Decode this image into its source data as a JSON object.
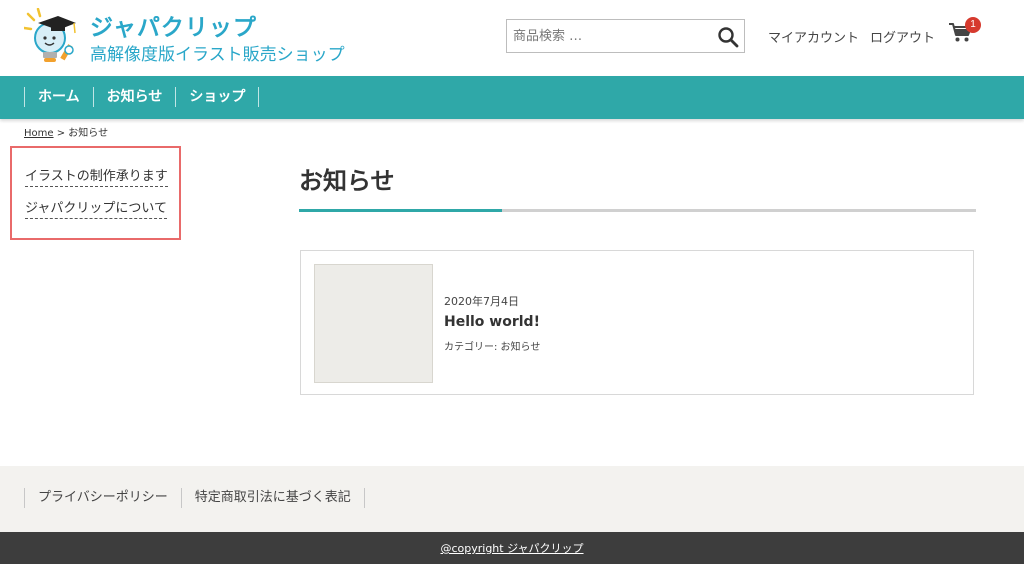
{
  "header": {
    "brand_name": "ジャパクリップ",
    "brand_subtitle": "高解像度版イラスト販売ショップ",
    "search_placeholder": "商品検索 …",
    "account_link": "マイアカウント",
    "logout_link": "ログアウト",
    "cart_count": "1",
    "icons": {
      "search": "search-icon",
      "cart": "cart-icon",
      "logo": "lightbulb-graduate-icon"
    },
    "colors": {
      "brand": "#2aa7c9",
      "badge": "#d63a2e"
    }
  },
  "nav": {
    "items": [
      {
        "label": "ホーム"
      },
      {
        "label": "お知らせ"
      },
      {
        "label": "ショップ"
      }
    ],
    "color": "#2fa8a8"
  },
  "breadcrumb": {
    "home": "Home",
    "separator": ">",
    "current": "お知らせ"
  },
  "sidebar": {
    "links": [
      {
        "label": "イラストの制作承ります"
      },
      {
        "label": "ジャパクリップについて"
      }
    ],
    "highlight_color": "#e96a6a"
  },
  "main": {
    "title": "お知らせ",
    "posts": [
      {
        "date": "2020年7月4日",
        "title": "Hello world!",
        "category": "カテゴリー: お知らせ"
      }
    ]
  },
  "footer": {
    "links": [
      {
        "label": "プライバシーポリシー"
      },
      {
        "label": "特定商取引法に基づく表記"
      }
    ],
    "copyright": "@copyright ジャパクリップ"
  }
}
